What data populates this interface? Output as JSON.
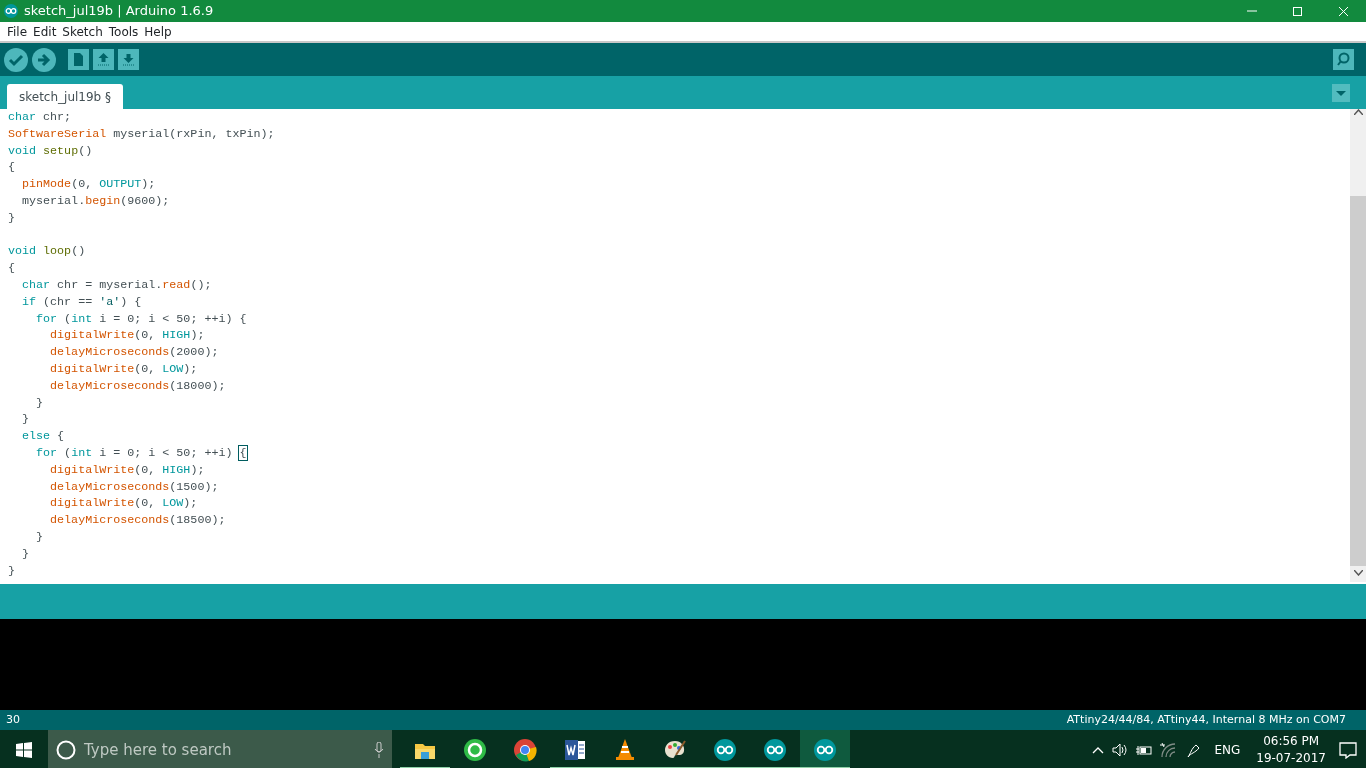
{
  "window": {
    "title": "sketch_jul19b | Arduino 1.6.9"
  },
  "menu": [
    "File",
    "Edit",
    "Sketch",
    "Tools",
    "Help"
  ],
  "toolbar": [
    {
      "kind": "verify"
    },
    {
      "kind": "upload"
    },
    {
      "kind": "new"
    },
    {
      "kind": "open"
    },
    {
      "kind": "save"
    }
  ],
  "tabs": [
    {
      "label": "sketch_jul19b §",
      "selected": true
    }
  ],
  "code": [
    {
      "kind": "code",
      "tokens": [
        {
          "kind": "kw",
          "text": "char"
        },
        {
          "kind": "p",
          "text": " chr;"
        }
      ]
    },
    {
      "kind": "code",
      "tokens": [
        {
          "kind": "fn",
          "text": "SoftwareSerial"
        },
        {
          "kind": "p",
          "text": " myserial(rxPin, txPin);"
        }
      ]
    },
    {
      "kind": "code",
      "tokens": [
        {
          "kind": "kw",
          "text": "void"
        },
        {
          "kind": "cb",
          "text": " setup"
        },
        {
          "kind": "p",
          "text": "()"
        }
      ]
    },
    {
      "kind": "code",
      "tokens": [
        {
          "kind": "p",
          "text": "{"
        }
      ]
    },
    {
      "kind": "code",
      "tokens": [
        {
          "kind": "fn",
          "text": "  pinMode"
        },
        {
          "kind": "p",
          "text": "(0, "
        },
        {
          "kind": "kw",
          "text": "OUTPUT"
        },
        {
          "kind": "p",
          "text": ");"
        }
      ]
    },
    {
      "kind": "code",
      "tokens": [
        {
          "kind": "p",
          "text": "  myserial."
        },
        {
          "kind": "fn",
          "text": "begin"
        },
        {
          "kind": "p",
          "text": "(9600);"
        }
      ]
    },
    {
      "kind": "code",
      "tokens": [
        {
          "kind": "p",
          "text": "}"
        }
      ]
    },
    {
      "kind": "blank"
    },
    {
      "kind": "code",
      "tokens": [
        {
          "kind": "kw",
          "text": "void"
        },
        {
          "kind": "cb",
          "text": " loop"
        },
        {
          "kind": "p",
          "text": "()"
        }
      ]
    },
    {
      "kind": "code",
      "tokens": [
        {
          "kind": "p",
          "text": "{"
        }
      ]
    },
    {
      "kind": "code",
      "tokens": [
        {
          "kind": "kw",
          "text": "  char"
        },
        {
          "kind": "p",
          "text": " chr = myserial."
        },
        {
          "kind": "fn",
          "text": "read"
        },
        {
          "kind": "p",
          "text": "();"
        }
      ]
    },
    {
      "kind": "code",
      "tokens": [
        {
          "kind": "kw",
          "text": "  if"
        },
        {
          "kind": "p",
          "text": " (chr == "
        },
        {
          "kind": "str",
          "text": "'a'"
        },
        {
          "kind": "p",
          "text": ") {"
        }
      ]
    },
    {
      "kind": "code",
      "tokens": [
        {
          "kind": "kw",
          "text": "    for"
        },
        {
          "kind": "p",
          "text": " ("
        },
        {
          "kind": "kw",
          "text": "int"
        },
        {
          "kind": "p",
          "text": " i = 0; i < 50; ++i) {"
        }
      ]
    },
    {
      "kind": "code",
      "tokens": [
        {
          "kind": "fn",
          "text": "      digitalWrite"
        },
        {
          "kind": "p",
          "text": "(0, "
        },
        {
          "kind": "kw",
          "text": "HIGH"
        },
        {
          "kind": "p",
          "text": ");"
        }
      ]
    },
    {
      "kind": "code",
      "tokens": [
        {
          "kind": "fn",
          "text": "      delayMicroseconds"
        },
        {
          "kind": "p",
          "text": "(2000);"
        }
      ]
    },
    {
      "kind": "code",
      "tokens": [
        {
          "kind": "fn",
          "text": "      digitalWrite"
        },
        {
          "kind": "p",
          "text": "(0, "
        },
        {
          "kind": "kw",
          "text": "LOW"
        },
        {
          "kind": "p",
          "text": ");"
        }
      ]
    },
    {
      "kind": "code",
      "tokens": [
        {
          "kind": "fn",
          "text": "      delayMicroseconds"
        },
        {
          "kind": "p",
          "text": "(18000);"
        }
      ]
    },
    {
      "kind": "code",
      "tokens": [
        {
          "kind": "p",
          "text": "    }"
        }
      ]
    },
    {
      "kind": "code",
      "tokens": [
        {
          "kind": "p",
          "text": "  }"
        }
      ]
    },
    {
      "kind": "code",
      "tokens": [
        {
          "kind": "kw",
          "text": "  else"
        },
        {
          "kind": "p",
          "text": " {"
        }
      ]
    },
    {
      "kind": "code",
      "tokens": [
        {
          "kind": "kw",
          "text": "    for"
        },
        {
          "kind": "p",
          "text": " ("
        },
        {
          "kind": "kw",
          "text": "int"
        },
        {
          "kind": "p",
          "text": " i = 0; i < 50; ++i) "
        },
        {
          "kind": "match",
          "text": "{"
        }
      ]
    },
    {
      "kind": "code",
      "tokens": [
        {
          "kind": "fn",
          "text": "      digitalWrite"
        },
        {
          "kind": "p",
          "text": "(0, "
        },
        {
          "kind": "kw",
          "text": "HIGH"
        },
        {
          "kind": "p",
          "text": ");"
        }
      ]
    },
    {
      "kind": "code",
      "tokens": [
        {
          "kind": "fn",
          "text": "      delayMicroseconds"
        },
        {
          "kind": "p",
          "text": "(1500);"
        }
      ]
    },
    {
      "kind": "code",
      "tokens": [
        {
          "kind": "fn",
          "text": "      digitalWrite"
        },
        {
          "kind": "p",
          "text": "(0, "
        },
        {
          "kind": "kw",
          "text": "LOW"
        },
        {
          "kind": "p",
          "text": ");"
        }
      ]
    },
    {
      "kind": "code",
      "tokens": [
        {
          "kind": "fn",
          "text": "      delayMicroseconds"
        },
        {
          "kind": "p",
          "text": "(18500);"
        }
      ]
    },
    {
      "kind": "code",
      "tokens": [
        {
          "kind": "p",
          "text": "    }"
        }
      ]
    },
    {
      "kind": "code",
      "tokens": [
        {
          "kind": "p",
          "text": "  }"
        }
      ]
    },
    {
      "kind": "code",
      "tokens": [
        {
          "kind": "p",
          "text": "}"
        }
      ]
    }
  ],
  "status_bar": {
    "line": "30",
    "board": "ATtiny24/44/84, ATtiny44, Internal 8 MHz on COM7"
  },
  "taskbar": {
    "search": {
      "placeholder": "Type here to search"
    },
    "apps": [
      {
        "kind": "folder",
        "running": true,
        "selected": false
      },
      {
        "kind": "chat",
        "running": false,
        "selected": false
      },
      {
        "kind": "browser",
        "running": false,
        "selected": false
      },
      {
        "kind": "word",
        "running": true,
        "selected": false
      },
      {
        "kind": "cone",
        "running": true,
        "selected": false
      },
      {
        "kind": "paint",
        "running": true,
        "selected": false
      },
      {
        "kind": "arduino",
        "running": true,
        "selected": false
      },
      {
        "kind": "arduino",
        "running": true,
        "selected": false
      },
      {
        "kind": "arduino",
        "running": true,
        "selected": true
      }
    ],
    "language": "ENG",
    "time": "06:56 PM",
    "date": "19-07-2017"
  }
}
